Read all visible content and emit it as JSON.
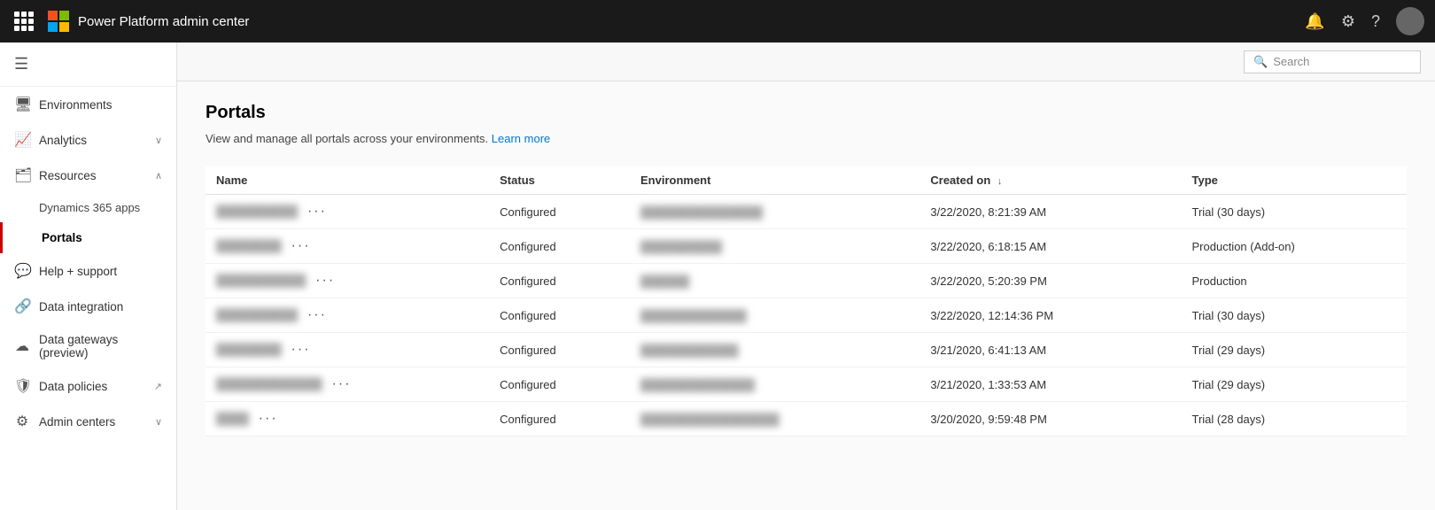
{
  "topbar": {
    "title": "Power Platform admin center",
    "search_label": "Search",
    "icons": {
      "notification": "🔔",
      "settings": "⚙",
      "help": "?"
    }
  },
  "sidebar": {
    "hamburger": "☰",
    "items": [
      {
        "id": "environments",
        "label": "Environments",
        "icon": "🖥",
        "hasChevron": false,
        "active": false
      },
      {
        "id": "analytics",
        "label": "Analytics",
        "icon": "📈",
        "hasChevron": true,
        "chevron": "∨",
        "active": false
      },
      {
        "id": "resources",
        "label": "Resources",
        "icon": "🗂",
        "hasChevron": true,
        "chevron": "∧",
        "active": false
      },
      {
        "id": "dynamics365apps",
        "label": "Dynamics 365 apps",
        "icon": "",
        "sub": true,
        "active": false
      },
      {
        "id": "portals",
        "label": "Portals",
        "icon": "",
        "sub": true,
        "active": true
      },
      {
        "id": "helpsupport",
        "label": "Help + support",
        "icon": "💬",
        "hasChevron": false,
        "active": false
      },
      {
        "id": "dataintegration",
        "label": "Data integration",
        "icon": "🔗",
        "hasChevron": false,
        "active": false
      },
      {
        "id": "datagateways",
        "label": "Data gateways (preview)",
        "icon": "☁",
        "hasChevron": false,
        "active": false
      },
      {
        "id": "datapolicies",
        "label": "Data policies",
        "icon": "🛡",
        "hasChevron": false,
        "active": false,
        "external": true
      },
      {
        "id": "admincenters",
        "label": "Admin centers",
        "icon": "⚙",
        "hasChevron": true,
        "chevron": "∨",
        "active": false
      }
    ]
  },
  "content": {
    "title": "Portals",
    "description": "View and manage all portals across your environments.",
    "learn_more": "Learn more",
    "table": {
      "columns": [
        "Name",
        "Status",
        "Environment",
        "Created on",
        "Type"
      ],
      "sort_col": "Created on",
      "rows": [
        {
          "name": "██████████",
          "status": "Configured",
          "environment": "███████████████",
          "created_on": "3/22/2020, 8:21:39 AM",
          "type": "Trial (30 days)"
        },
        {
          "name": "████████",
          "status": "Configured",
          "environment": "██████████",
          "created_on": "3/22/2020, 6:18:15 AM",
          "type": "Production (Add-on)"
        },
        {
          "name": "███████████",
          "status": "Configured",
          "environment": "██████",
          "created_on": "3/22/2020, 5:20:39 PM",
          "type": "Production"
        },
        {
          "name": "██████████",
          "status": "Configured",
          "environment": "█████████████",
          "created_on": "3/22/2020, 12:14:36 PM",
          "type": "Trial (30 days)"
        },
        {
          "name": "████████",
          "status": "Configured",
          "environment": "████████████",
          "created_on": "3/21/2020, 6:41:13 AM",
          "type": "Trial (29 days)"
        },
        {
          "name": "█████████████",
          "status": "Configured",
          "environment": "██████████████",
          "created_on": "3/21/2020, 1:33:53 AM",
          "type": "Trial (29 days)"
        },
        {
          "name": "████",
          "status": "Configured",
          "environment": "█████████████████",
          "created_on": "3/20/2020, 9:59:48 PM",
          "type": "Trial (28 days)"
        }
      ]
    }
  },
  "colors": {
    "accent_red": "#c00",
    "link_blue": "#0078d4",
    "topbar_bg": "#1a1a1a"
  }
}
